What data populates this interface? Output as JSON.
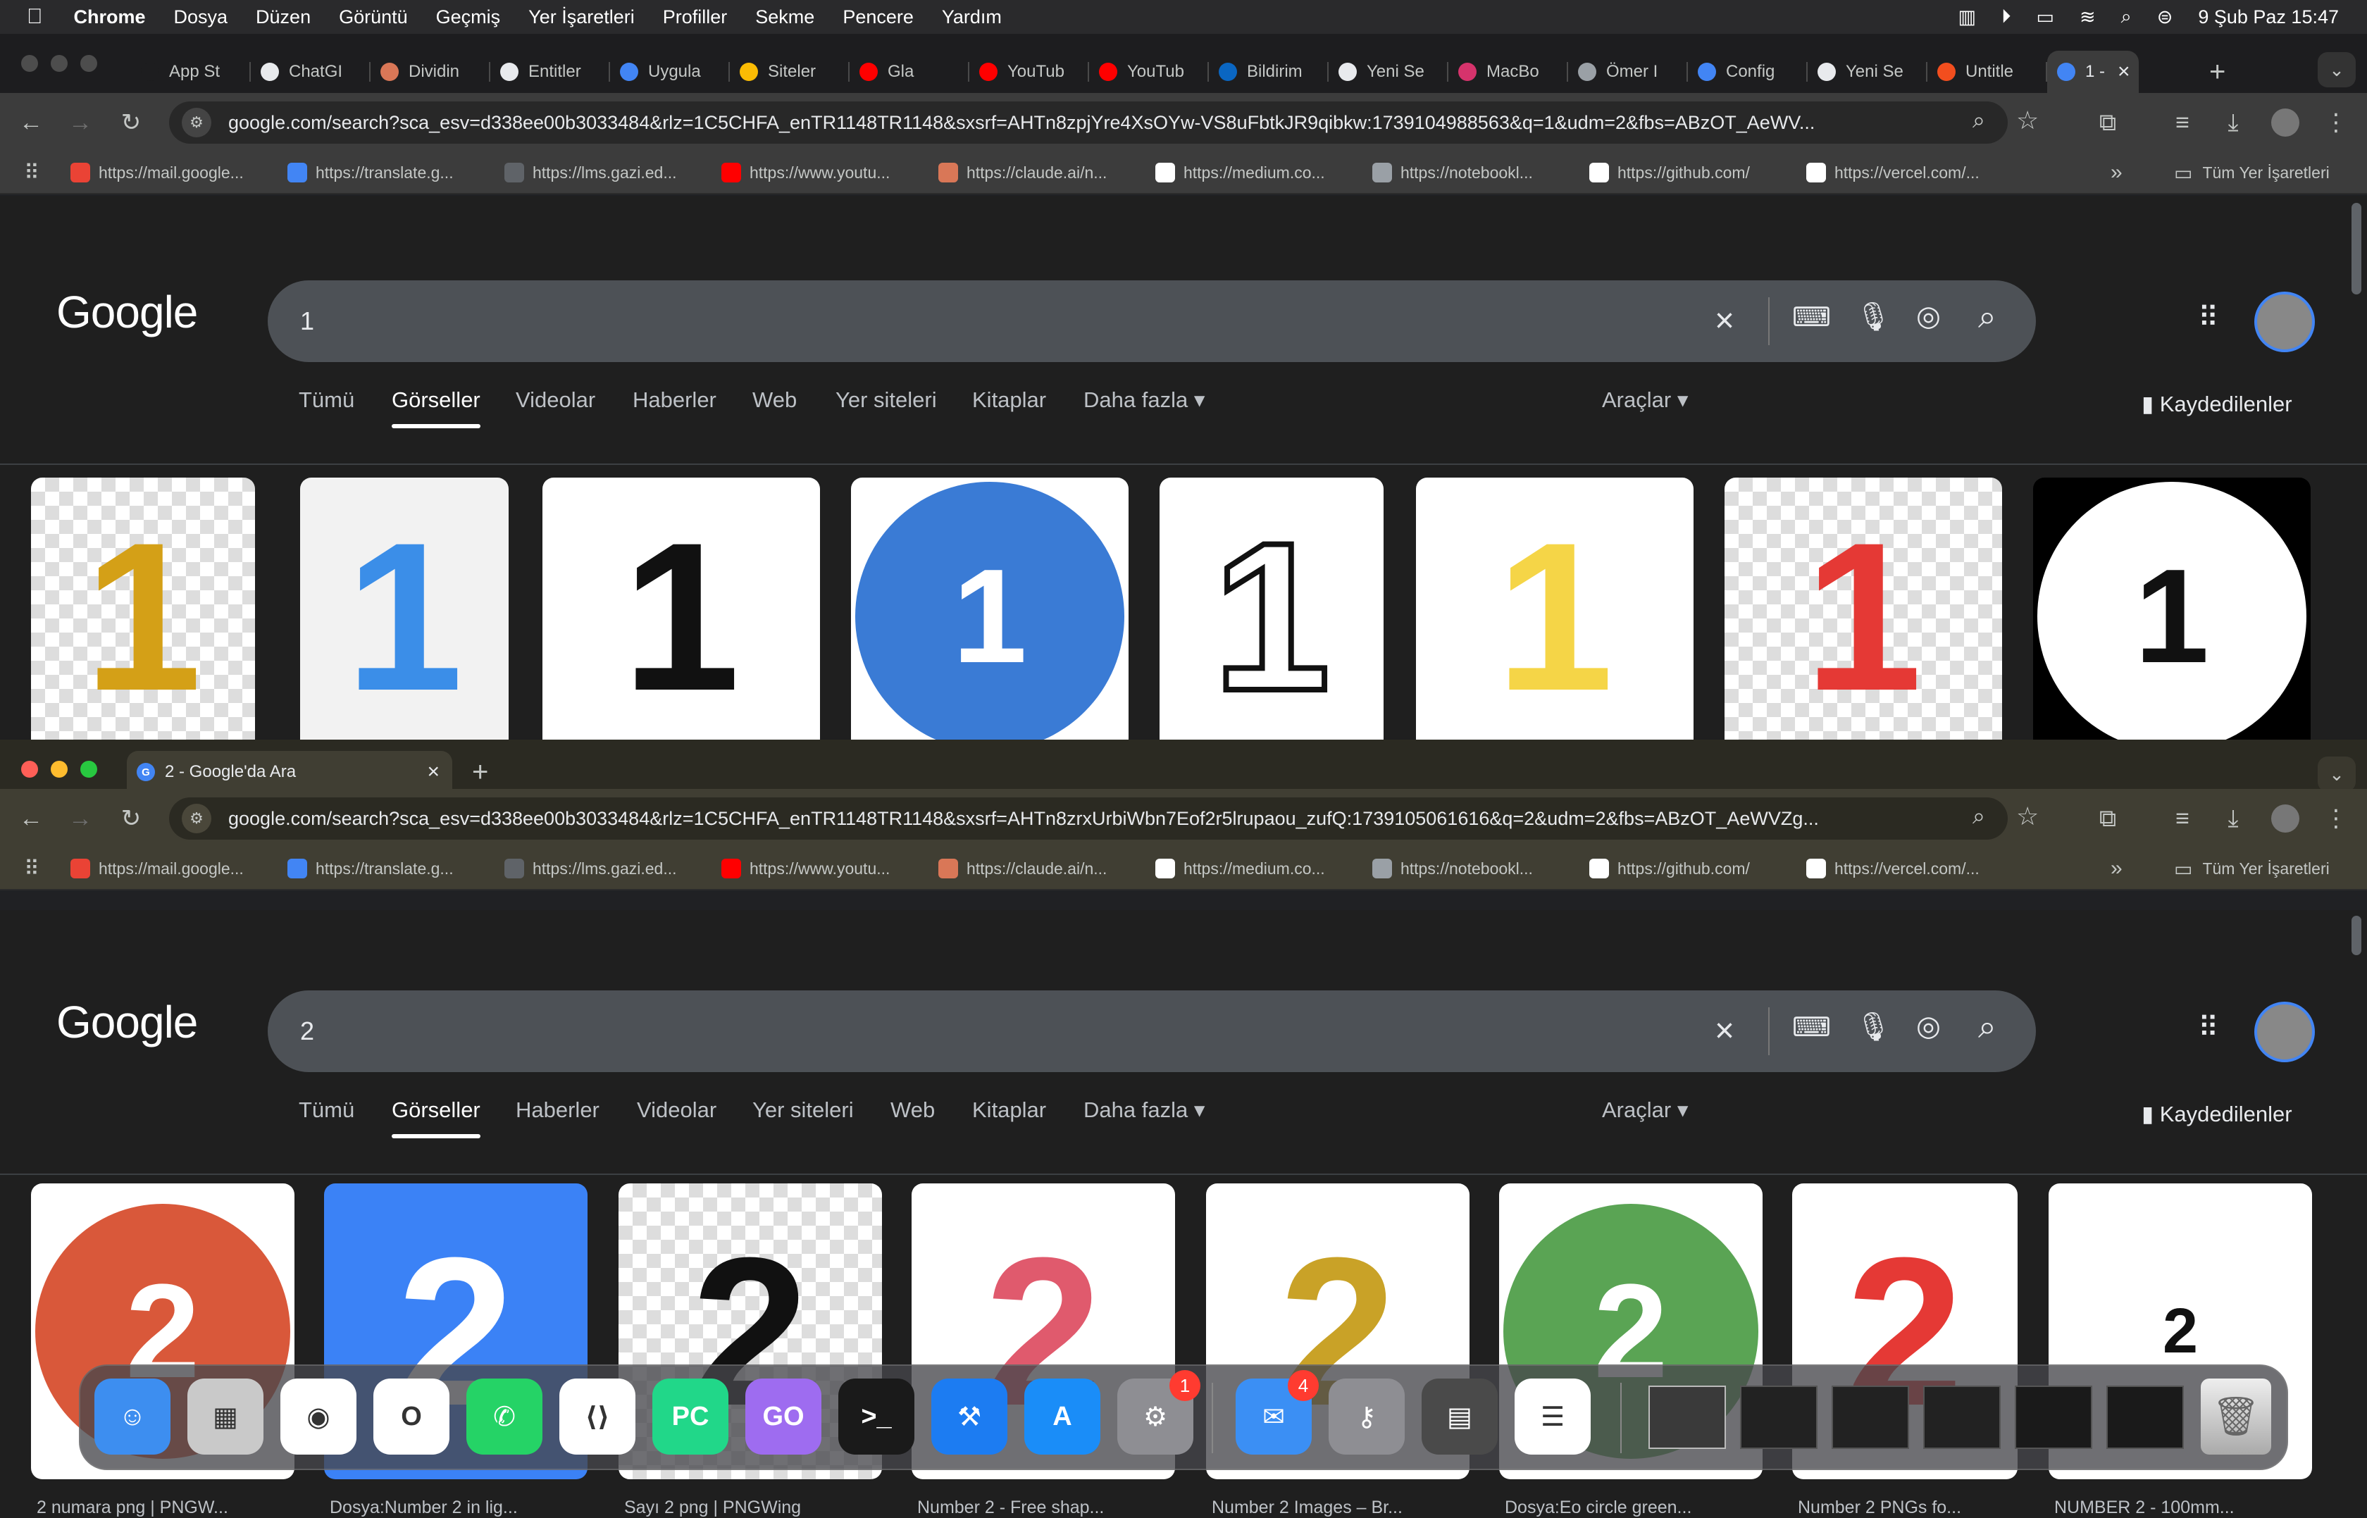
{
  "menubar": {
    "app": "Chrome",
    "items": [
      "Dosya",
      "Düzen",
      "Görüntü",
      "Geçmiş",
      "Yer İşaretleri",
      "Profiller",
      "Sekme",
      "Pencere",
      "Yardım"
    ],
    "clock": "9 Şub Paz  15:47"
  },
  "top_window": {
    "tabs": [
      {
        "label": "App St",
        "color": "#1d1d1f",
        "icon": "app-store-icon"
      },
      {
        "label": "ChatGI",
        "color": "#e8eaed",
        "icon": "chatgpt-icon"
      },
      {
        "label": "Dividin",
        "color": "#d97757",
        "icon": "claude-icon"
      },
      {
        "label": "Entitler",
        "color": "#e8eaed",
        "icon": "chatgpt-icon"
      },
      {
        "label": "Uygula",
        "color": "#4285f4",
        "icon": "site-icon"
      },
      {
        "label": "Siteler",
        "color": "#fbbc04",
        "icon": "drive-icon"
      },
      {
        "label": "Gla",
        "color": "#ff0000",
        "icon": "youtube-icon"
      },
      {
        "label": "YouTub",
        "color": "#ff0000",
        "icon": "youtube-icon"
      },
      {
        "label": "YouTub",
        "color": "#ff0000",
        "icon": "youtube-icon"
      },
      {
        "label": "Bildirim",
        "color": "#0a66c2",
        "icon": "linkedin-icon"
      },
      {
        "label": "Yeni Se",
        "color": "#e8eaed",
        "icon": "chatgpt-icon"
      },
      {
        "label": "MacBo",
        "color": "#d6336c",
        "icon": "site-icon"
      },
      {
        "label": "Ömer I",
        "color": "#9aa0a6",
        "icon": "site-icon"
      },
      {
        "label": "Config",
        "color": "#4285f4",
        "icon": "site-icon"
      },
      {
        "label": "Yeni Se",
        "color": "#e8eaed",
        "icon": "chatgpt-icon"
      },
      {
        "label": "Untitle",
        "color": "#f24e1e",
        "icon": "figma-icon"
      },
      {
        "label": "1 -",
        "color": "#4285f4",
        "icon": "google-icon"
      }
    ],
    "url": "google.com/search?sca_esv=d338ee00b3033484&rlz=1C5CHFA_enTR1148TR1148&sxsrf=AHTn8zpjYre4XsOYw-VS8uFbtkJR9qibkw:1739104988563&q=1&udm=2&fbs=ABzOT_AeWV...",
    "query": "1",
    "nav": [
      "Tümü",
      "Görseller",
      "Videolar",
      "Haberler",
      "Web",
      "Yer siteleri",
      "Kitaplar",
      "Daha fazla"
    ],
    "active_nav": "Görseller",
    "thumbs": [
      {
        "glyph": "1",
        "fg": "#d4a017",
        "bg": "checker"
      },
      {
        "glyph": "1",
        "fg": "#3b8ee8",
        "bg": "#f2f2f2"
      },
      {
        "glyph": "1",
        "fg": "#111111",
        "bg": "#ffffff"
      },
      {
        "glyph": "1",
        "fg": "#ffffff",
        "bg": "#ffffff",
        "circle": "#3a7bd5"
      },
      {
        "glyph": "1",
        "fg": "#ffffff",
        "bg": "#ffffff",
        "outline": true
      },
      {
        "glyph": "1",
        "fg": "#f5d547",
        "bg": "#ffffff"
      },
      {
        "glyph": "1",
        "fg": "#e53935",
        "bg": "checker"
      },
      {
        "glyph": "1",
        "fg": "#111111",
        "bg": "#000000",
        "circle": "#ffffff"
      }
    ]
  },
  "bottom_window": {
    "tab_title": "2 - Google'da Ara",
    "url": "google.com/search?sca_esv=d338ee00b3033484&rlz=1C5CHFA_enTR1148TR1148&sxsrf=AHTn8zrxUrbiWbn7Eof2r5lrupaou_zufQ:1739105061616&q=2&udm=2&fbs=ABzOT_AeWVZg...",
    "query": "2",
    "nav": [
      "Tümü",
      "Görseller",
      "Haberler",
      "Videolar",
      "Yer siteleri",
      "Web",
      "Kitaplar",
      "Daha fazla"
    ],
    "active_nav": "Görseller",
    "thumbs": [
      {
        "glyph": "2",
        "fg": "#ffffff",
        "bg": "#ffffff",
        "circle": "#d9583a"
      },
      {
        "glyph": "2",
        "fg": "#ffffff",
        "bg": "#3b82f6"
      },
      {
        "glyph": "2",
        "fg": "#111111",
        "bg": "checker"
      },
      {
        "glyph": "2",
        "fg": "#e05a6d",
        "bg": "#ffffff"
      },
      {
        "glyph": "2",
        "fg": "#c9a227",
        "bg": "#ffffff"
      },
      {
        "glyph": "2",
        "fg": "#ffffff",
        "bg": "#ffffff",
        "circle": "#5aa454"
      },
      {
        "glyph": "2",
        "fg": "#e53935",
        "bg": "#ffffff"
      },
      {
        "glyph": "2",
        "fg": "#111111",
        "bg": "#ffffff",
        "small": true
      }
    ],
    "captions": [
      "2 numara png | PNGW...",
      "Dosya:Number 2 in lig...",
      "Sayı 2 png | PNGWing",
      "Number 2 - Free shap...",
      "Number 2 Images – Br...",
      "Dosya:Eo circle green...",
      "Number 2 PNGs fo...",
      "NUMBER 2 - 100mm..."
    ]
  },
  "bookmarks": [
    {
      "label": "https://mail.google...",
      "color": "#ea4335"
    },
    {
      "label": "https://translate.g...",
      "color": "#4285f4"
    },
    {
      "label": "https://lms.gazi.ed...",
      "color": "#5f6368"
    },
    {
      "label": "https://www.youtu...",
      "color": "#ff0000"
    },
    {
      "label": "https://claude.ai/n...",
      "color": "#d97757"
    },
    {
      "label": "https://medium.co...",
      "color": "#ffffff"
    },
    {
      "label": "https://notebookl...",
      "color": "#9aa0a6"
    },
    {
      "label": "https://github.com/",
      "color": "#ffffff"
    },
    {
      "label": "https://vercel.com/...",
      "color": "#ffffff"
    }
  ],
  "bookmarks_all": "Tüm Yer İşaretleri",
  "tools_label": "Araçlar",
  "saved_label": "Kaydedilenler",
  "google_logo": "Google",
  "dock": {
    "apps": [
      {
        "name": "Finder",
        "color": "#3d8ef0",
        "glyph": "☺"
      },
      {
        "name": "Launchpad",
        "color": "#c9c9c9",
        "glyph": "▦"
      },
      {
        "name": "Chrome",
        "color": "#ffffff",
        "glyph": "◉"
      },
      {
        "name": "Opera",
        "color": "#ffffff",
        "glyph": "O"
      },
      {
        "name": "WhatsApp",
        "color": "#25d366",
        "glyph": "✆"
      },
      {
        "name": "VS Code",
        "color": "#ffffff",
        "glyph": "⟨⟩"
      },
      {
        "name": "PyCharm",
        "color": "#21d789",
        "glyph": "PC"
      },
      {
        "name": "GoLand",
        "color": "#9e6cf0",
        "glyph": "GO"
      },
      {
        "name": "Terminal",
        "color": "#1a1a1a",
        "glyph": ">_"
      },
      {
        "name": "Xcode",
        "color": "#1c7cf2",
        "glyph": "⚒"
      },
      {
        "name": "App Store",
        "color": "#1a8df8",
        "glyph": "A"
      },
      {
        "name": "System Settings",
        "color": "#8e8e93",
        "glyph": "⚙",
        "badge": "1"
      },
      {
        "name": "Mail",
        "color": "#3b8ff4",
        "glyph": "✉",
        "badge": "4"
      },
      {
        "name": "Keychain",
        "color": "#8e8e93",
        "glyph": "⚷"
      },
      {
        "name": "Calculator",
        "color": "#4a4a4a",
        "glyph": "▤"
      },
      {
        "name": "Reminders",
        "color": "#ffffff",
        "glyph": "☰"
      }
    ]
  }
}
